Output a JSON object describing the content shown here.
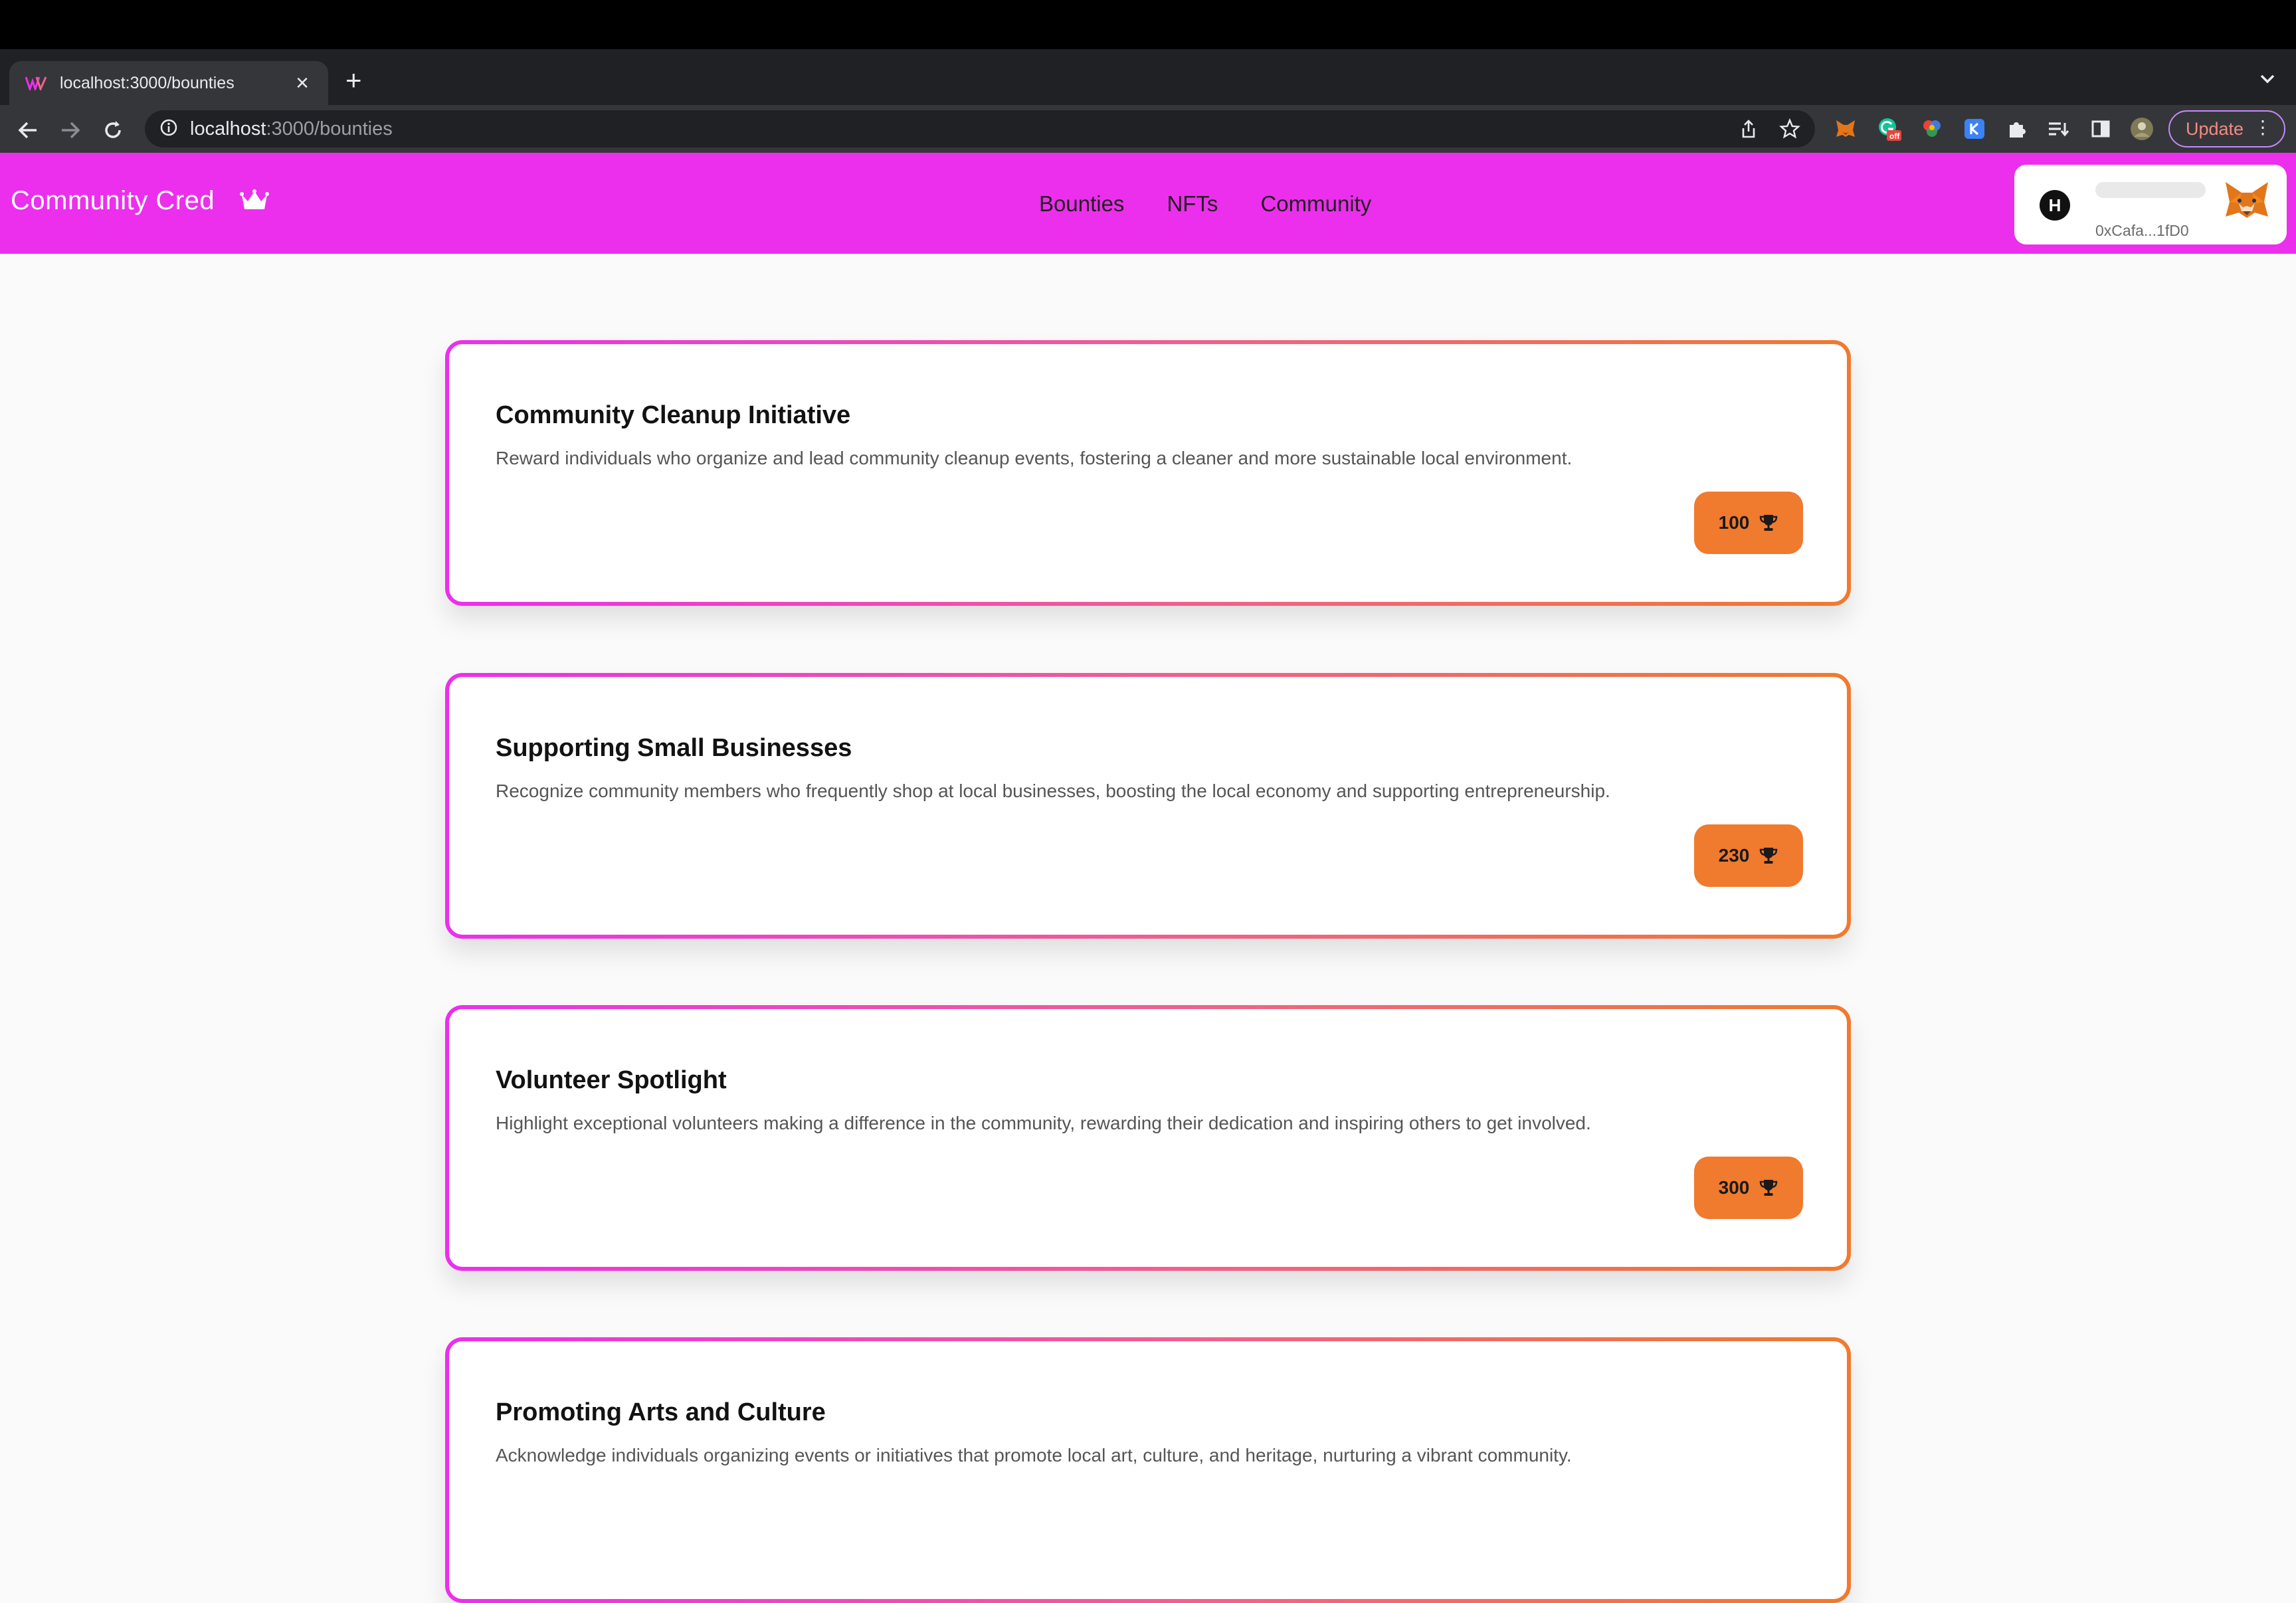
{
  "browser": {
    "tab_title": "localhost:3000/bounties",
    "tab_close": "×",
    "new_tab": "+",
    "url_host": "localhost",
    "url_path": ":3000/bounties",
    "update_label": "Update",
    "menu_dots": "⋮",
    "extension_badge": "off"
  },
  "app": {
    "brand": "Community Cred",
    "nav": [
      "Bounties",
      "NFTs",
      "Community"
    ],
    "wallet": {
      "avatar_letter": "H",
      "address": "0xCafa...1fD0"
    }
  },
  "bounties": [
    {
      "title": "Community Cleanup Initiative",
      "description": "Reward individuals who organize and lead community cleanup events, fostering a cleaner and more sustainable local environment.",
      "reward": "100"
    },
    {
      "title": "Supporting Small Businesses",
      "description": "Recognize community members who frequently shop at local businesses, boosting the local economy and supporting entrepreneurship.",
      "reward": "230"
    },
    {
      "title": "Volunteer Spotlight",
      "description": "Highlight exceptional volunteers making a difference in the community, rewarding their dedication and inspiring others to get involved.",
      "reward": "300"
    },
    {
      "title": "Promoting Arts and Culture",
      "description": "Acknowledge individuals organizing events or initiatives that promote local art, culture, and heritage, nurturing a vibrant community.",
      "reward": ""
    }
  ],
  "colors": {
    "brand_magenta": "#ec2fec",
    "reward_orange": "#f07a2e",
    "page_background": "#fafafa"
  }
}
